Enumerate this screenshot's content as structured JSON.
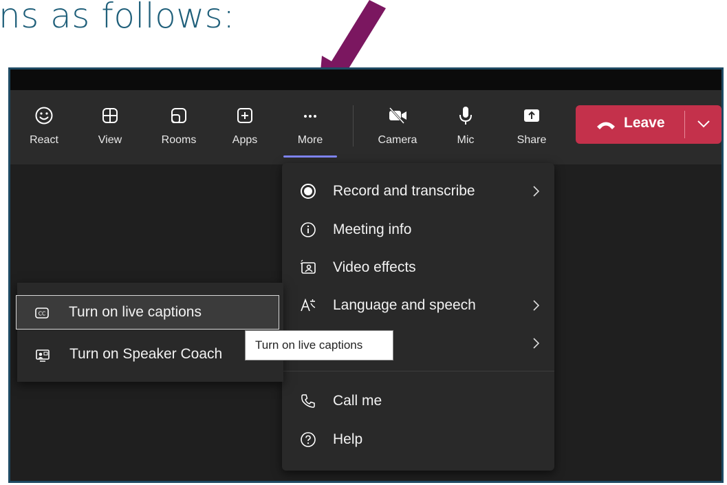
{
  "heading": "ns as follows:",
  "toolbar": {
    "react": "React",
    "view": "View",
    "rooms": "Rooms",
    "apps": "Apps",
    "more": "More",
    "camera": "Camera",
    "mic": "Mic",
    "share": "Share",
    "leave": "Leave"
  },
  "more_menu": {
    "items": [
      {
        "label": "Record and transcribe",
        "icon": "record-icon",
        "submenu": true
      },
      {
        "label": "Meeting info",
        "icon": "info-icon",
        "submenu": false
      },
      {
        "label": "Video effects",
        "icon": "video-effects-icon",
        "submenu": false
      },
      {
        "label": "Language and speech",
        "icon": "language-icon",
        "submenu": true
      },
      {
        "label": "",
        "icon": "",
        "submenu": true
      },
      {
        "label": "Call me",
        "icon": "phone-icon",
        "submenu": false
      },
      {
        "label": "Help",
        "icon": "help-icon",
        "submenu": false
      }
    ]
  },
  "language_submenu": {
    "items": [
      {
        "label": "Turn on live captions",
        "icon": "captions-icon",
        "highlighted": true
      },
      {
        "label": "Turn on Speaker Coach",
        "icon": "speaker-coach-icon",
        "highlighted": false
      }
    ]
  },
  "tooltip": "Turn on live captions",
  "colors": {
    "leave_red": "#c4314b",
    "accent_underline": "#7f85f5",
    "arrow_purple": "#7b1760",
    "frame_border": "#1e4a63",
    "heading_teal": "#1f5f7a"
  }
}
